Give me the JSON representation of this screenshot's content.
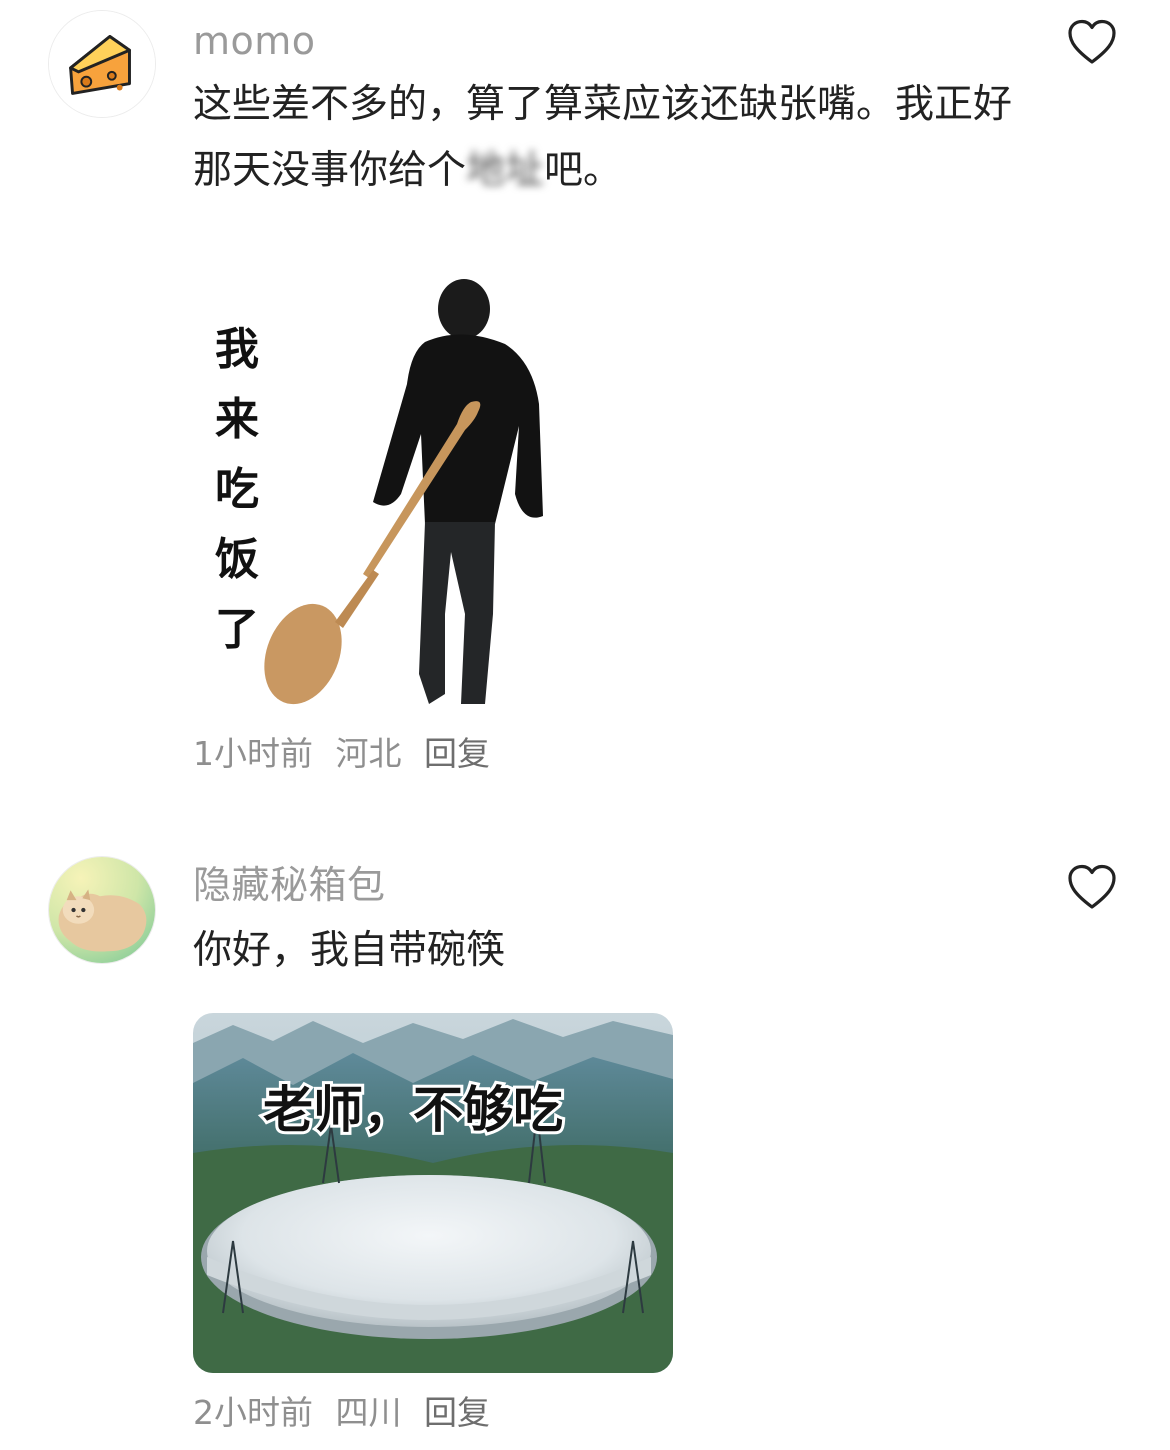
{
  "comments": [
    {
      "username": "momo",
      "text_main": "这些差不多的，算了算菜应该还缺张嘴。我正好那天没事你给个",
      "text_blurred": "地址",
      "text_tail": "吧。",
      "sticker": {
        "caption_chars": [
          "我",
          "来",
          "吃",
          "饭",
          "了"
        ]
      },
      "time": "1小时前",
      "location": "河北",
      "reply_label": "回复",
      "avatar_icon": "cheese-icon",
      "like_icon": "heart-outline-icon"
    },
    {
      "username": "隐藏秘箱包",
      "text_main": "你好，我自带碗筷",
      "sticker": {
        "caption": "老师，不够吃"
      },
      "time": "2小时前",
      "location": "四川",
      "reply_label": "回复",
      "avatar_icon": "cat-avatar",
      "like_icon": "heart-outline-icon"
    }
  ],
  "colors": {
    "username": "#9a9a9a",
    "text": "#222222",
    "meta": "#8f8f8f",
    "cheese": "#f7a23c"
  }
}
